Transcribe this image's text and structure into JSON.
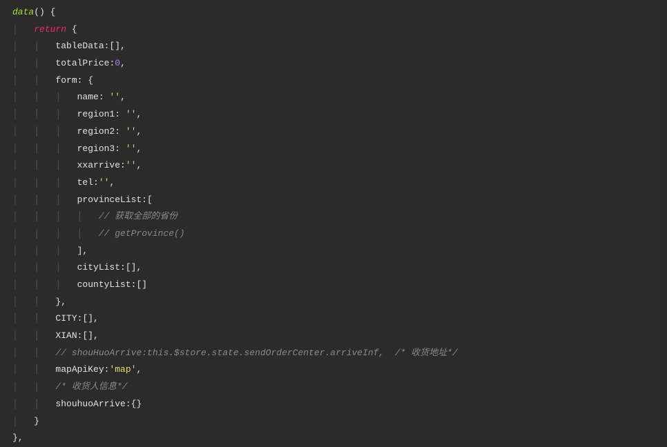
{
  "lines": {
    "l1": {
      "seg": [
        {
          "c": "func",
          "t": "data"
        },
        {
          "c": "punct",
          "t": "() {"
        }
      ]
    },
    "l2": {
      "seg": [
        {
          "c": "guide",
          "t": "│   "
        },
        {
          "c": "kw",
          "t": "return"
        },
        {
          "c": "punct",
          "t": " {"
        }
      ]
    },
    "l3": {
      "seg": [
        {
          "c": "guide",
          "t": "│   │   "
        },
        {
          "c": "prop",
          "t": "tableData"
        },
        {
          "c": "punct",
          "t": ":[],"
        }
      ]
    },
    "l4": {
      "seg": [
        {
          "c": "guide",
          "t": "│   │   "
        },
        {
          "c": "prop",
          "t": "totalPrice"
        },
        {
          "c": "punct",
          "t": ":"
        },
        {
          "c": "num",
          "t": "0"
        },
        {
          "c": "punct",
          "t": ","
        }
      ]
    },
    "l5": {
      "seg": [
        {
          "c": "guide",
          "t": "│   │   "
        },
        {
          "c": "prop",
          "t": "form"
        },
        {
          "c": "punct",
          "t": ": {"
        }
      ]
    },
    "l6": {
      "seg": [
        {
          "c": "guide",
          "t": "│   │   │   "
        },
        {
          "c": "prop",
          "t": "name"
        },
        {
          "c": "punct",
          "t": ": "
        },
        {
          "c": "str",
          "t": "''"
        },
        {
          "c": "punct",
          "t": ","
        }
      ]
    },
    "l7": {
      "seg": [
        {
          "c": "guide",
          "t": "│   │   │   "
        },
        {
          "c": "prop",
          "t": "region1"
        },
        {
          "c": "punct",
          "t": ": "
        },
        {
          "c": "str",
          "t": "''"
        },
        {
          "c": "punct",
          "t": ","
        }
      ]
    },
    "l8": {
      "seg": [
        {
          "c": "guide",
          "t": "│   │   │   "
        },
        {
          "c": "prop",
          "t": "region2"
        },
        {
          "c": "punct",
          "t": ": "
        },
        {
          "c": "str",
          "t": "''"
        },
        {
          "c": "punct",
          "t": ","
        }
      ]
    },
    "l9": {
      "seg": [
        {
          "c": "guide",
          "t": "│   │   │   "
        },
        {
          "c": "prop",
          "t": "region3"
        },
        {
          "c": "punct",
          "t": ": "
        },
        {
          "c": "str",
          "t": "''"
        },
        {
          "c": "punct",
          "t": ","
        }
      ]
    },
    "l10": {
      "seg": [
        {
          "c": "guide",
          "t": "│   │   │   "
        },
        {
          "c": "prop",
          "t": "xxarrive"
        },
        {
          "c": "punct",
          "t": ":"
        },
        {
          "c": "str",
          "t": "''"
        },
        {
          "c": "punct",
          "t": ","
        }
      ]
    },
    "l11": {
      "seg": [
        {
          "c": "guide",
          "t": "│   │   │   "
        },
        {
          "c": "prop",
          "t": "tel"
        },
        {
          "c": "punct",
          "t": ":"
        },
        {
          "c": "str",
          "t": "''"
        },
        {
          "c": "punct",
          "t": ","
        }
      ]
    },
    "l12": {
      "seg": [
        {
          "c": "guide",
          "t": "│   │   │   "
        },
        {
          "c": "prop",
          "t": "provinceList"
        },
        {
          "c": "punct",
          "t": ":["
        }
      ]
    },
    "l13": {
      "seg": [
        {
          "c": "guide",
          "t": "│   │   │   │   "
        },
        {
          "c": "comment",
          "t": "// 获取全部的省份"
        }
      ]
    },
    "l14": {
      "seg": [
        {
          "c": "guide",
          "t": "│   │   │   │   "
        },
        {
          "c": "comment",
          "t": "// getProvince()"
        }
      ]
    },
    "l15": {
      "seg": [
        {
          "c": "guide",
          "t": "│   │   │   "
        },
        {
          "c": "punct",
          "t": "],"
        }
      ]
    },
    "l16": {
      "seg": [
        {
          "c": "guide",
          "t": "│   │   │   "
        },
        {
          "c": "prop",
          "t": "cityList"
        },
        {
          "c": "punct",
          "t": ":[],"
        }
      ]
    },
    "l17": {
      "seg": [
        {
          "c": "guide",
          "t": "│   │   │   "
        },
        {
          "c": "prop",
          "t": "countyList"
        },
        {
          "c": "punct",
          "t": ":[]"
        }
      ]
    },
    "l18": {
      "seg": [
        {
          "c": "guide",
          "t": "│   │   "
        },
        {
          "c": "punct",
          "t": "},"
        }
      ]
    },
    "l19": {
      "seg": [
        {
          "c": "guide",
          "t": "│   │   "
        },
        {
          "c": "prop",
          "t": "CITY"
        },
        {
          "c": "punct",
          "t": ":[],"
        }
      ]
    },
    "l20": {
      "seg": [
        {
          "c": "guide",
          "t": "│   │   "
        },
        {
          "c": "prop",
          "t": "XIAN"
        },
        {
          "c": "punct",
          "t": ":[],"
        }
      ]
    },
    "l21": {
      "seg": [
        {
          "c": "guide",
          "t": "│   │   "
        },
        {
          "c": "comment ital",
          "t": "// shouHuoArrive:this.$store.state.sendOrderCenter.arriveInf,  /* 收货地址*/"
        }
      ]
    },
    "l22": {
      "seg": [
        {
          "c": "guide",
          "t": "│   │   "
        },
        {
          "c": "prop",
          "t": "mapApiKey"
        },
        {
          "c": "punct",
          "t": ":"
        },
        {
          "c": "str",
          "t": "'map'"
        },
        {
          "c": "punct",
          "t": ","
        }
      ]
    },
    "l23": {
      "seg": [
        {
          "c": "guide",
          "t": "│   │   "
        },
        {
          "c": "comment ital",
          "t": "/* 收货人信息*/"
        }
      ]
    },
    "l24": {
      "seg": [
        {
          "c": "guide",
          "t": "│   │   "
        },
        {
          "c": "prop",
          "t": "shouhuoArrive"
        },
        {
          "c": "punct",
          "t": ":{}"
        }
      ]
    },
    "l25": {
      "seg": [
        {
          "c": "guide",
          "t": "│   "
        },
        {
          "c": "punct",
          "t": "}"
        }
      ]
    },
    "l26": {
      "seg": [
        {
          "c": "punct",
          "t": "},"
        }
      ]
    }
  }
}
